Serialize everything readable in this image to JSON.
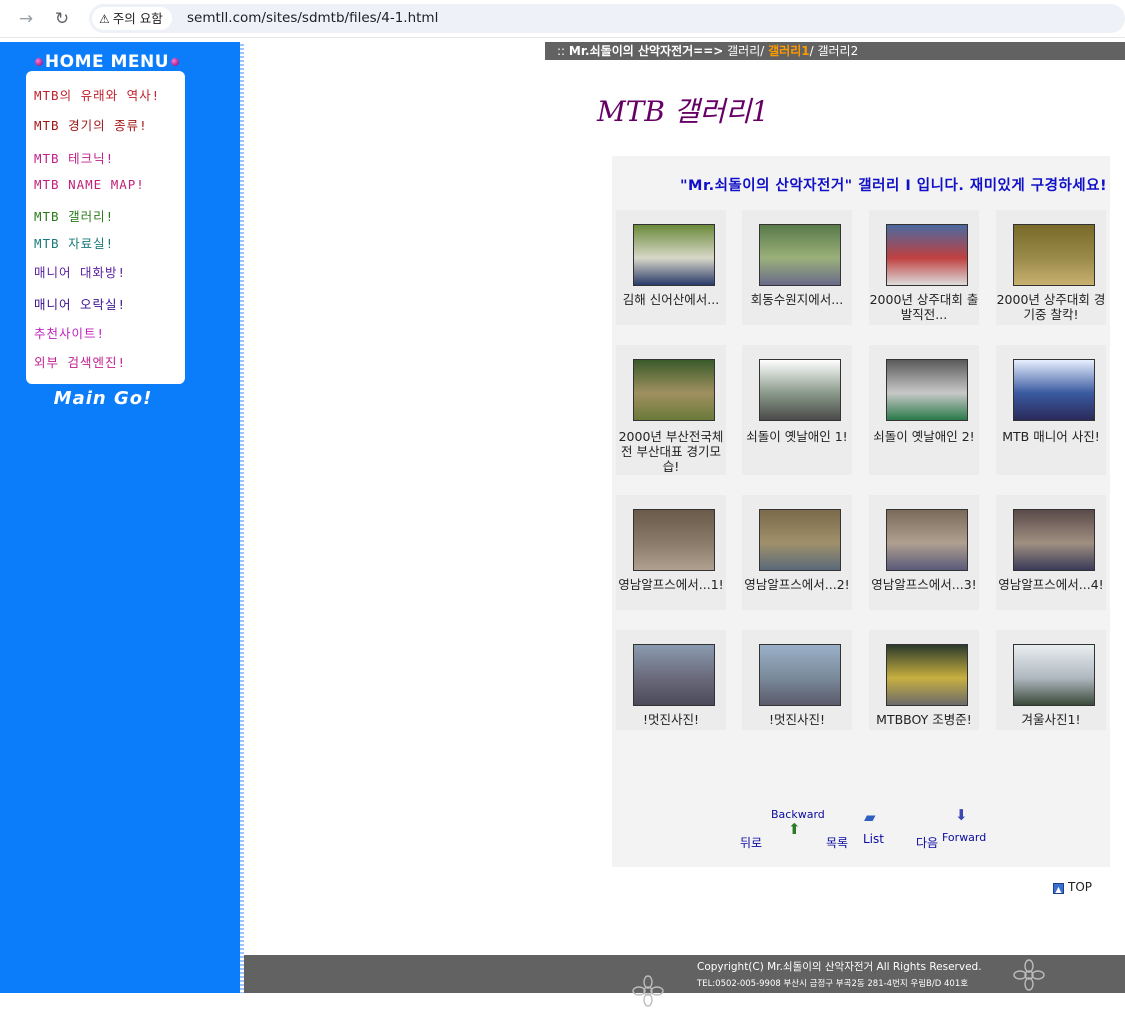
{
  "browser": {
    "security_label": "주의 요함",
    "url": "semtll.com/sites/sdmtb/files/4-1.html"
  },
  "sidebar": {
    "title": "HOME MENU",
    "items": [
      {
        "label": "MTB의 유래와 역사!",
        "color": "#c0202a"
      },
      {
        "label": "MTB 경기의 종류!",
        "color": "#a01818"
      },
      {
        "label": "MTB 테크닉!",
        "color": "#c0208a"
      },
      {
        "label": "MTB NAME MAP!",
        "color": "#c0207a"
      },
      {
        "label": "MTB 갤러리!",
        "color": "#2a7a1a"
      },
      {
        "label": "MTB 자료실!",
        "color": "#1a7a7a"
      },
      {
        "label": "매니어 대화방!",
        "color": "#5a20a0"
      },
      {
        "label": "매니어 오락실!",
        "color": "#3a1090"
      },
      {
        "label": "추천사이트!",
        "color": "#c020c0"
      },
      {
        "label": "외부 검색엔진!",
        "color": "#c02090"
      }
    ],
    "main_go": "Main Go!"
  },
  "breadcrumb": {
    "prefix": ":: ",
    "site": "Mr.쇠돌이의 산악자전거==>",
    "crumb1": " 갤러리/ ",
    "current": "갤러리1",
    "crumb2": "/ 갤러리2"
  },
  "page": {
    "title": "MTB 갤러리1",
    "marquee": "\"Mr.쇠돌이의 산악자전거\" 갤러리 I 입니다. 재미있게 구경하세요!"
  },
  "gallery": [
    {
      "caption": "김해 신어산에서...",
      "icon": "photo-group-bikes"
    },
    {
      "caption": "회동수원지에서...",
      "icon": "photo-collage"
    },
    {
      "caption": "2000년 상주대회 출발직전...",
      "icon": "photo-race-start"
    },
    {
      "caption": "2000년 상주대회 경기중 찰칵!",
      "icon": "photo-trail"
    },
    {
      "caption": "2000년 부산전국체전 부산대표 경기모습!",
      "icon": "photo-forest-ride"
    },
    {
      "caption": "쇠돌이 옛날애인 1!",
      "icon": "photo-bike-1"
    },
    {
      "caption": "쇠돌이 옛날애인 2!",
      "icon": "photo-bike-2"
    },
    {
      "caption": "MTB 매니어 사진!",
      "icon": "photo-rider-portrait"
    },
    {
      "caption": "영남알프스에서...1!",
      "icon": "photo-mountain-road"
    },
    {
      "caption": "영남알프스에서...2!",
      "icon": "photo-grass-ride"
    },
    {
      "caption": "영남알프스에서...3!",
      "icon": "photo-group-field"
    },
    {
      "caption": "영남알프스에서...4!",
      "icon": "photo-group-pose"
    },
    {
      "caption": "!멋진사진!",
      "icon": "photo-landscape-1"
    },
    {
      "caption": "!멋진사진!",
      "icon": "photo-landscape-2"
    },
    {
      "caption": "MTBBOY 조병준!",
      "icon": "photo-mtbboy"
    },
    {
      "caption": "겨울사진1!",
      "icon": "photo-winter"
    }
  ],
  "pager": {
    "back_label": "뒤로",
    "backward_label": "Backward",
    "list_kor": "목록",
    "list_label": "List",
    "next_label": "다음",
    "forward_label": "Forward"
  },
  "top_label": "TOP",
  "footer": {
    "copyright": "Copyright(C)  Mr.쇠돌이의 산악자전거  All Rights Reserved.",
    "address": "TEL:0502-005-9908 부산시 금정구 부곡2동 281-4번지 우림B/D 401호"
  }
}
